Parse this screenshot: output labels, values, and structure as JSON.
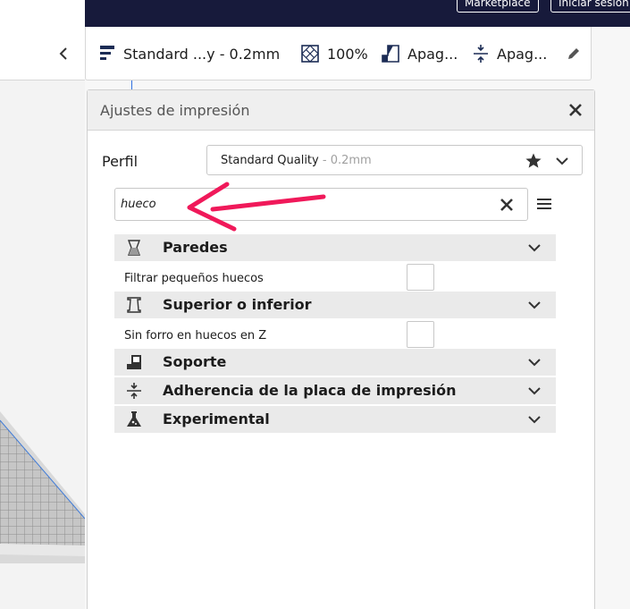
{
  "topbar": {
    "marketplace_label": "Marketplace",
    "login_label": "Iniciar sesión"
  },
  "settings_bar": {
    "profile": "Standard ...y - 0.2mm",
    "infill": "100%",
    "support": "Apag...",
    "adhesion": "Apag..."
  },
  "panel": {
    "title": "Ajustes de impresión",
    "profile_label": "Perfil",
    "profile_name": "Standard Quality",
    "profile_sub": " - 0.2mm",
    "search_value": "hueco"
  },
  "categories": [
    {
      "label": "Paredes",
      "icon": "walls-icon"
    },
    {
      "label": "Superior o inferior",
      "icon": "top-bottom-icon"
    },
    {
      "label": "Soporte",
      "icon": "support-icon"
    },
    {
      "label": "Adherencia de la placa de impresión",
      "icon": "adhesion-icon"
    },
    {
      "label": "Experimental",
      "icon": "experimental-icon"
    }
  ],
  "settings": [
    {
      "label": "Filtrar pequeños huecos",
      "checked": false
    },
    {
      "label": "Sin forro en huecos en Z",
      "checked": false
    }
  ],
  "colors": {
    "topbar": "#171a3b",
    "annotation_arrow": "#f0195a",
    "category_bg": "#eaeaea"
  }
}
